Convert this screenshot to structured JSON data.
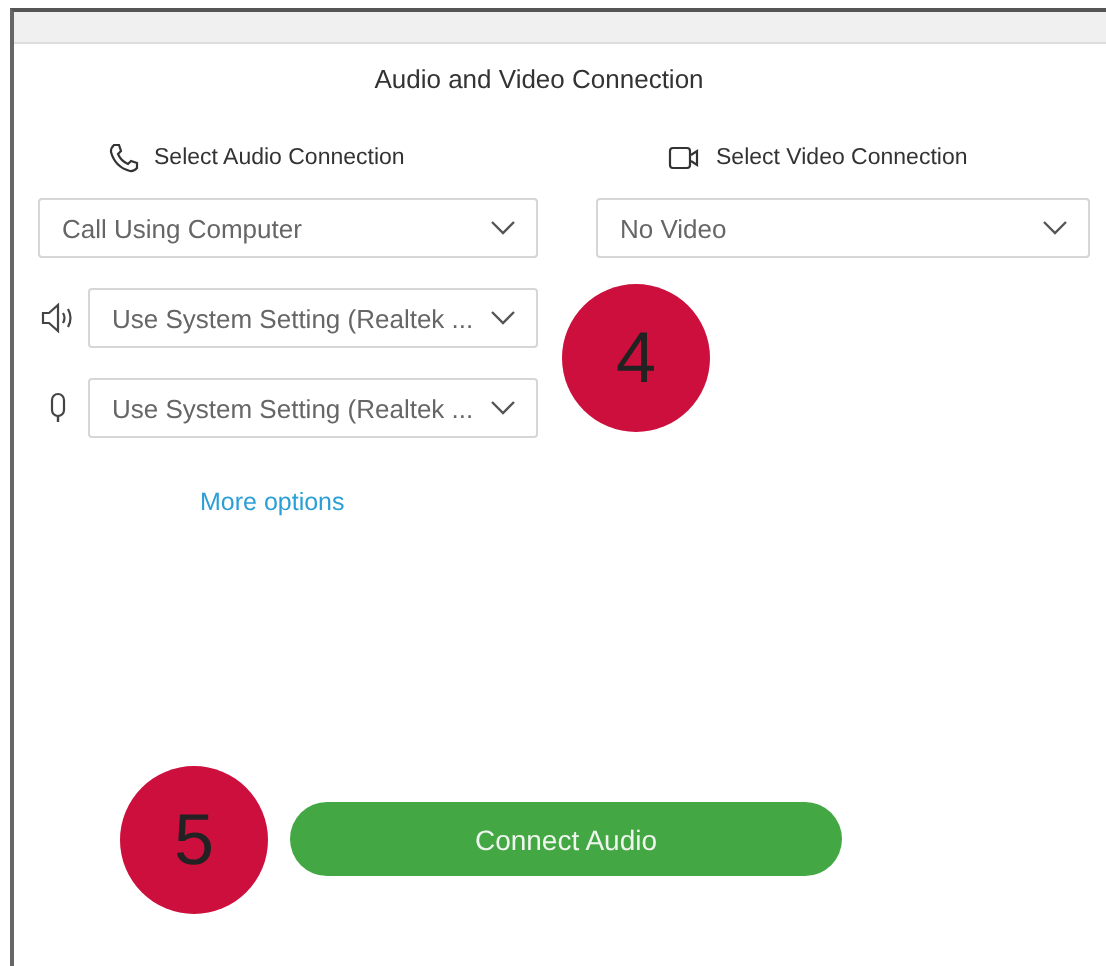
{
  "window": {
    "title": "Audio and Video Connection"
  },
  "audio": {
    "heading": "Select Audio Connection",
    "connection": {
      "value": "Call Using Computer"
    },
    "devices": [
      {
        "kind": "speaker",
        "value": "Use System Setting (Realtek ..."
      },
      {
        "kind": "microphone",
        "value": "Use System Setting (Realtek ..."
      }
    ],
    "more_options": "More options"
  },
  "video": {
    "heading": "Select Video Connection",
    "connection": {
      "value": "No Video"
    }
  },
  "annotations": [
    {
      "label": "4"
    },
    {
      "label": "5"
    }
  ],
  "connect_button": "Connect Audio"
}
